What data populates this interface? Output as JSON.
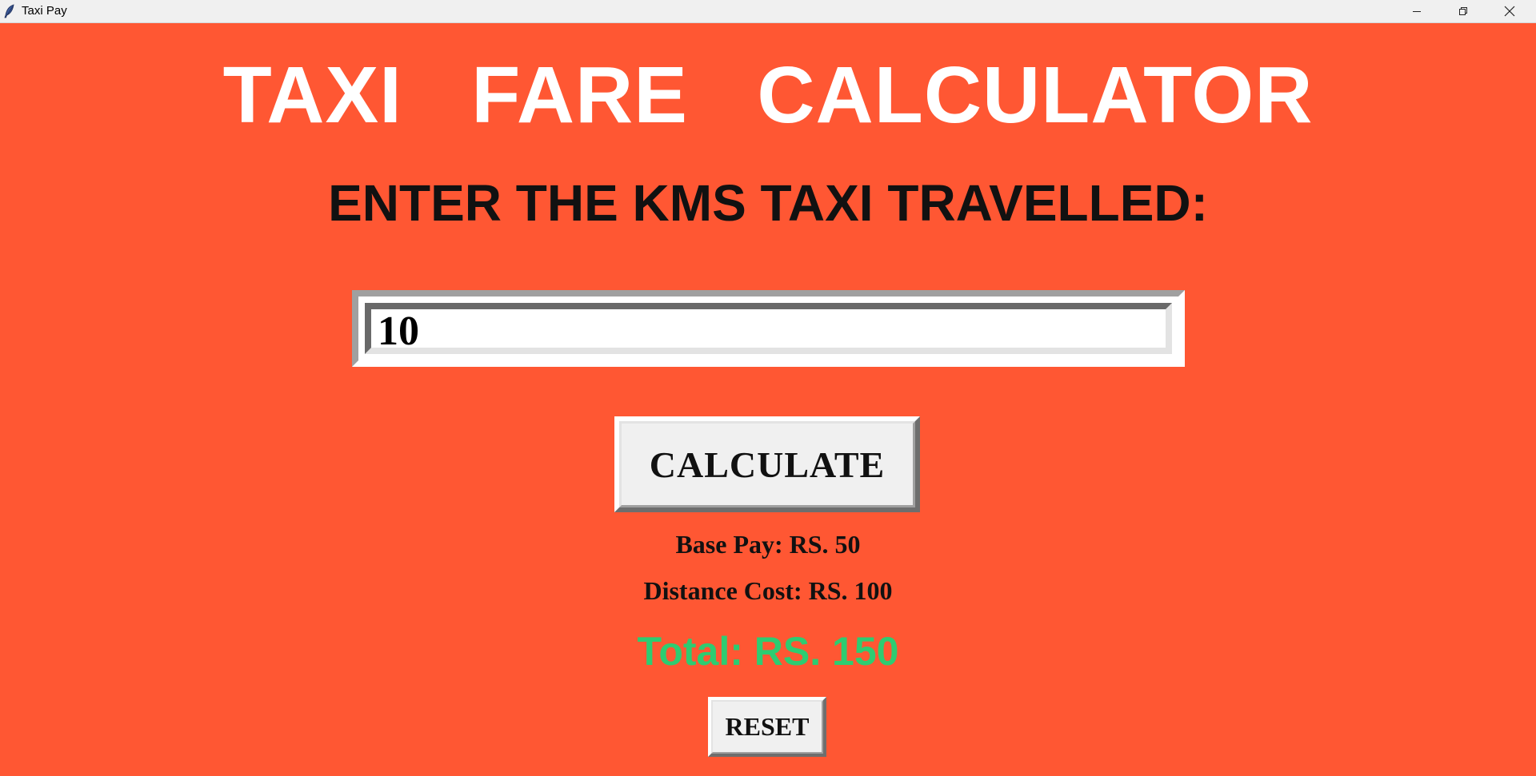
{
  "window": {
    "title": "Taxi Pay",
    "icon": "feather-icon",
    "controls": [
      "minimize-icon",
      "restore-icon",
      "close-icon"
    ]
  },
  "colors": {
    "background": "#ff5733",
    "title_text": "#ffffff",
    "total_text": "#2ecc71"
  },
  "header": {
    "title": "TAXI   FARE   CALCULATOR"
  },
  "form": {
    "prompt": "ENTER THE KMS TAXI TRAVELLED:",
    "km_value": "10",
    "calculate_label": "CALCULATE"
  },
  "results": {
    "base_pay": "Base Pay: RS. 50",
    "distance_cost": "Distance Cost: RS. 100",
    "total": "Total: RS. 150"
  },
  "actions": {
    "reset_label": "RESET"
  }
}
